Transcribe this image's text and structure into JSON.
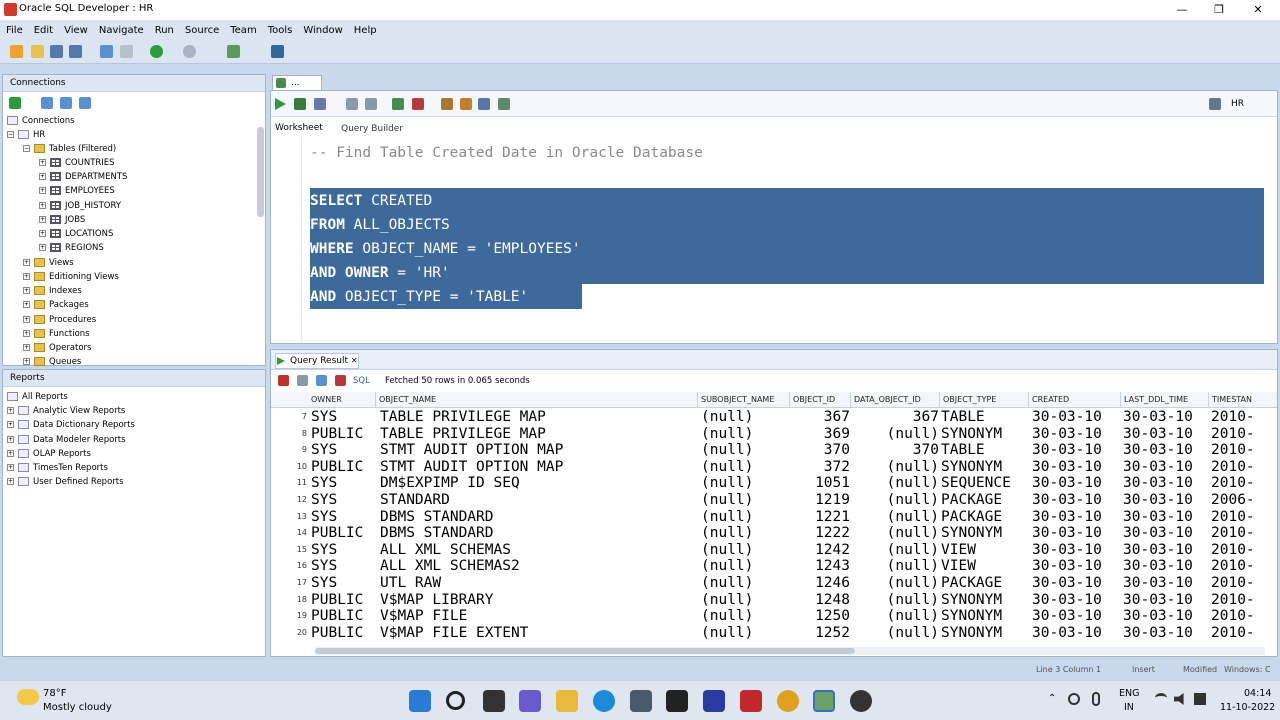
{
  "window": {
    "title": "Oracle SQL Developer : HR",
    "controls": [
      "—",
      "❐",
      "✕"
    ]
  },
  "menu": [
    "File",
    "Edit",
    "View",
    "Navigate",
    "Run",
    "Source",
    "Team",
    "Tools",
    "Window",
    "Help"
  ],
  "connections": {
    "header": "Connections",
    "root": "Connections",
    "conn": "HR",
    "tables_node": "Tables (Filtered)",
    "tables": [
      "COUNTRIES",
      "DEPARTMENTS",
      "EMPLOYEES",
      "JOB_HISTORY",
      "JOBS",
      "LOCATIONS",
      "REGIONS"
    ],
    "nodes": [
      "Views",
      "Editioning Views",
      "Indexes",
      "Packages",
      "Procedures",
      "Functions",
      "Operators",
      "Queues"
    ]
  },
  "reports": {
    "header": "Reports",
    "items": [
      "All Reports",
      "Analytic View Reports",
      "Data Dictionary Reports",
      "Data Modeler Reports",
      "OLAP Reports",
      "TimesTen Reports",
      "User Defined Reports"
    ]
  },
  "editor": {
    "tab": "...",
    "connection": "HR",
    "subtabs": [
      "Worksheet",
      "Query Builder"
    ],
    "comment": "-- Find Table Created Date in Oracle Database",
    "lines": [
      {
        "kw": "SELECT",
        "rest": " CREATED"
      },
      {
        "kw": "FROM",
        "rest": " ALL_OBJECTS"
      },
      {
        "kw": "WHERE",
        "rest": " OBJECT_NAME = 'EMPLOYEES'"
      },
      {
        "kw": "AND OWNER",
        "rest": " = 'HR'"
      },
      {
        "kw": "AND",
        "rest": " OBJECT_TYPE = 'TABLE'"
      }
    ]
  },
  "result": {
    "tab": "Query Result",
    "sql_label": "SQL",
    "status": "Fetched 50 rows in 0.065 seconds",
    "columns": [
      "OWNER",
      "OBJECT_NAME",
      "SUBOBJECT_NAME",
      "OBJECT_ID",
      "DATA_OBJECT_ID",
      "OBJECT_TYPE",
      "CREATED",
      "LAST_DDL_TIME",
      "TIMESTAN"
    ],
    "rows": [
      [
        "7",
        "SYS",
        "TABLE PRIVILEGE MAP",
        "(null)",
        "367",
        "367",
        "TABLE",
        "30-03-10",
        "30-03-10",
        "2010-"
      ],
      [
        "8",
        "PUBLIC",
        "TABLE PRIVILEGE MAP",
        "(null)",
        "369",
        "(null)",
        "SYNONYM",
        "30-03-10",
        "30-03-10",
        "2010-"
      ],
      [
        "9",
        "SYS",
        "STMT AUDIT OPTION MAP",
        "(null)",
        "370",
        "370",
        "TABLE",
        "30-03-10",
        "30-03-10",
        "2010-"
      ],
      [
        "10",
        "PUBLIC",
        "STMT AUDIT OPTION MAP",
        "(null)",
        "372",
        "(null)",
        "SYNONYM",
        "30-03-10",
        "30-03-10",
        "2010-"
      ],
      [
        "11",
        "SYS",
        "DM$EXPIMP ID SEQ",
        "(null)",
        "1051",
        "(null)",
        "SEQUENCE",
        "30-03-10",
        "30-03-10",
        "2010-"
      ],
      [
        "12",
        "SYS",
        "STANDARD",
        "(null)",
        "1219",
        "(null)",
        "PACKAGE",
        "30-03-10",
        "30-03-10",
        "2006-"
      ],
      [
        "13",
        "SYS",
        "DBMS STANDARD",
        "(null)",
        "1221",
        "(null)",
        "PACKAGE",
        "30-03-10",
        "30-03-10",
        "2010-"
      ],
      [
        "14",
        "PUBLIC",
        "DBMS STANDARD",
        "(null)",
        "1222",
        "(null)",
        "SYNONYM",
        "30-03-10",
        "30-03-10",
        "2010-"
      ],
      [
        "15",
        "SYS",
        "ALL XML SCHEMAS",
        "(null)",
        "1242",
        "(null)",
        "VIEW",
        "30-03-10",
        "30-03-10",
        "2010-"
      ],
      [
        "16",
        "SYS",
        "ALL XML SCHEMAS2",
        "(null)",
        "1243",
        "(null)",
        "VIEW",
        "30-03-10",
        "30-03-10",
        "2010-"
      ],
      [
        "17",
        "SYS",
        "UTL RAW",
        "(null)",
        "1246",
        "(null)",
        "PACKAGE",
        "30-03-10",
        "30-03-10",
        "2010-"
      ],
      [
        "18",
        "PUBLIC",
        "V$MAP LIBRARY",
        "(null)",
        "1248",
        "(null)",
        "SYNONYM",
        "30-03-10",
        "30-03-10",
        "2010-"
      ],
      [
        "19",
        "PUBLIC",
        "V$MAP FILE",
        "(null)",
        "1250",
        "(null)",
        "SYNONYM",
        "30-03-10",
        "30-03-10",
        "2010-"
      ],
      [
        "20",
        "PUBLIC",
        "V$MAP FILE EXTENT",
        "(null)",
        "1252",
        "(null)",
        "SYNONYM",
        "30-03-10",
        "30-03-10",
        "2010-"
      ]
    ]
  },
  "statusbar": {
    "position": "Line 3 Column 1",
    "mode": "Insert",
    "modified": "Modified",
    "os": "Windows: C"
  },
  "taskbar": {
    "weather_temp": "78°F",
    "weather_desc": "Mostly cloudy",
    "lang1": "ENG",
    "lang2": "IN",
    "time": "04:14",
    "date": "11-10-2022"
  }
}
